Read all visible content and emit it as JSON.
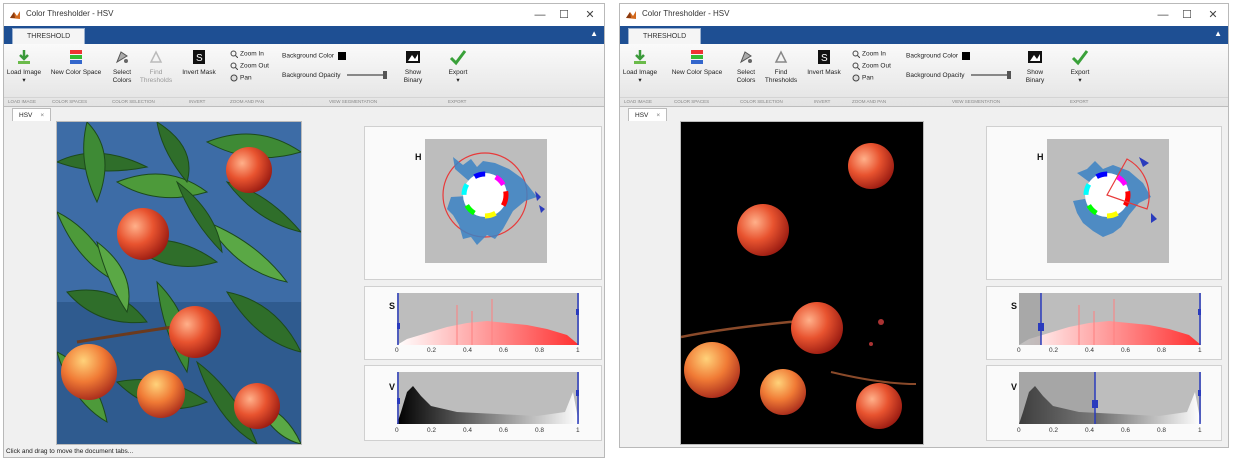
{
  "windows": [
    {
      "title": "Color Thresholder - HSV",
      "ribbon_tab": "THRESHOLD",
      "buttons": {
        "load_image": "Load Image",
        "new_color_space": "New Color Space",
        "select_colors": "Select Colors",
        "find_thresholds": "Find Thresholds",
        "invert_mask": "Invert Mask",
        "zoom_in": "Zoom In",
        "zoom_out": "Zoom Out",
        "pan": "Pan",
        "background_color": "Background Color",
        "background_opacity": "Background Opacity",
        "show_binary": "Show Binary",
        "export": "Export"
      },
      "groups": [
        "LOAD IMAGE",
        "COLOR SPACES",
        "COLOR SELECTION",
        "INVERT",
        "ZOOM AND PAN",
        "VIEW SEGMENTATION",
        "EXPORT"
      ],
      "doc_tab": "HSV",
      "channels": [
        "H",
        "S",
        "V"
      ],
      "ticks": [
        "0",
        "0.2",
        "0.4",
        "0.6",
        "0.8",
        "1"
      ],
      "status": "Click and drag to move the document tabs...",
      "thresholds": {
        "s_min": 0.0,
        "s_max": 1.0,
        "v_min": 0.0,
        "v_max": 1.0
      }
    },
    {
      "title": "Color Thresholder - HSV",
      "ribbon_tab": "THRESHOLD",
      "buttons": {
        "load_image": "Load Image",
        "new_color_space": "New Color Space",
        "select_colors": "Select Colors",
        "find_thresholds": "Find Thresholds",
        "invert_mask": "Invert Mask",
        "zoom_in": "Zoom In",
        "zoom_out": "Zoom Out",
        "pan": "Pan",
        "background_color": "Background Color",
        "background_opacity": "Background Opacity",
        "show_binary": "Show Binary",
        "export": "Export"
      },
      "groups": [
        "LOAD IMAGE",
        "COLOR SPACES",
        "COLOR SELECTION",
        "INVERT",
        "ZOOM AND PAN",
        "VIEW SEGMENTATION",
        "EXPORT"
      ],
      "doc_tab": "HSV",
      "channels": [
        "H",
        "S",
        "V"
      ],
      "ticks": [
        "0",
        "0.2",
        "0.4",
        "0.6",
        "0.8",
        "1"
      ],
      "thresholds": {
        "s_min": 0.12,
        "s_max": 1.0,
        "v_min": 0.42,
        "v_max": 1.0
      }
    }
  ],
  "colors": {
    "ribbon_blue": "#1e4f93",
    "histogram_bg": "#bdbdbd",
    "slider_blue": "#2a3bbd",
    "mask_bg": "#000000"
  },
  "window_controls": {
    "minimize": "—",
    "maximize": "☐",
    "close": "✕"
  }
}
